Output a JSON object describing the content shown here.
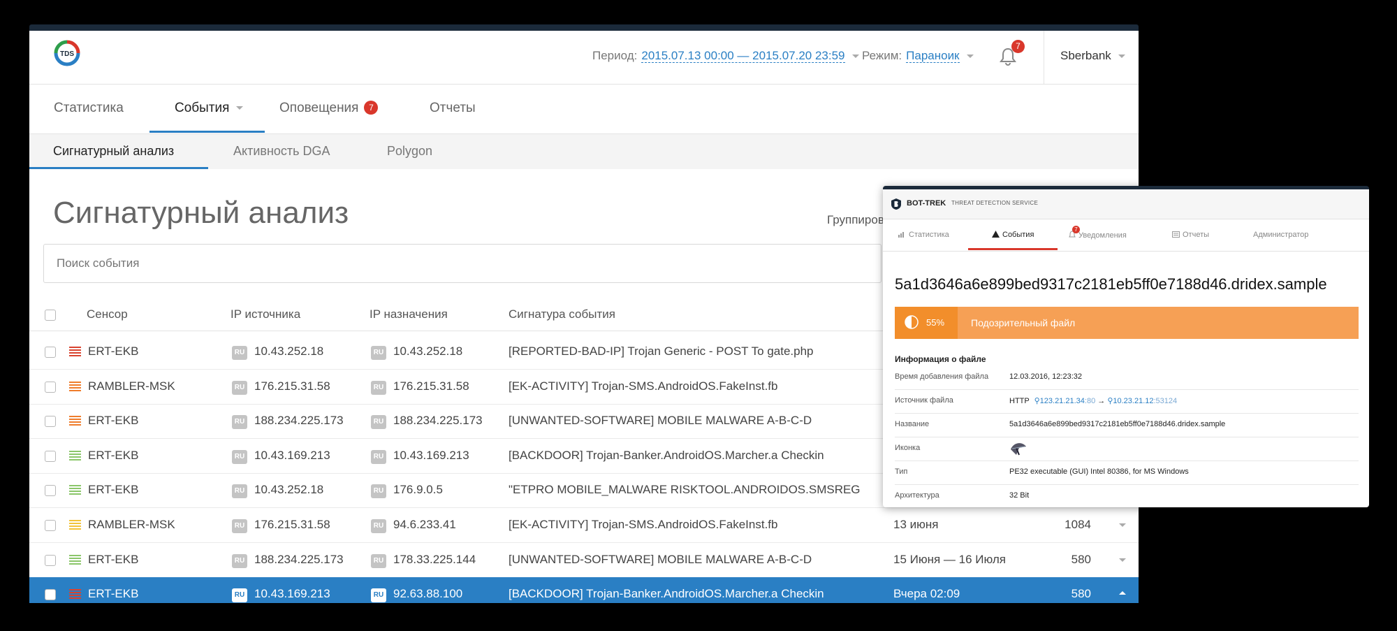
{
  "header": {
    "logo_text": "TDS",
    "period_label": "Период:",
    "period_value": "2015.07.13 00:00 — 2015.07.20 23:59",
    "mode_label": "Режим:",
    "mode_value": "Параноик",
    "notifications_count": "7",
    "user": "Sberbank"
  },
  "nav": {
    "tabs": [
      {
        "label": "Статистика"
      },
      {
        "label": "События"
      },
      {
        "label": "Оповещения",
        "badge": "7"
      },
      {
        "label": "Отчеты"
      }
    ],
    "subtabs": [
      {
        "label": "Сигнатурный анализ"
      },
      {
        "label": "Активность DGA"
      },
      {
        "label": "Polygon"
      }
    ]
  },
  "main": {
    "title": "Сигнатурный анализ",
    "group_label": "Группиров",
    "search_placeholder": "Поиск события"
  },
  "table": {
    "headers": [
      "Сенсор",
      "IP источника",
      "IP назначения",
      "Сигнатура события"
    ],
    "rows": [
      {
        "sensor": "ERT-EKB",
        "severity": "critical",
        "src_cc": "RU",
        "src": "10.43.252.18",
        "dst_cc": "RU",
        "dst": "10.43.252.18",
        "signature": "[REPORTED-BAD-IP] Trojan Generic - POST To gate.php",
        "date": "",
        "count": ""
      },
      {
        "sensor": "RAMBLER-MSK",
        "severity": "high",
        "src_cc": "RU",
        "src": "176.215.31.58",
        "dst_cc": "RU",
        "dst": "176.215.31.58",
        "signature": "[EK-ACTIVITY] Trojan-SMS.AndroidOS.FakeInst.fb",
        "date": "",
        "count": ""
      },
      {
        "sensor": "ERT-EKB",
        "severity": "high",
        "src_cc": "RU",
        "src": "188.234.225.173",
        "dst_cc": "RU",
        "dst": "188.234.225.173",
        "signature": "[UNWANTED-SOFTWARE] MOBILE MALWARE A-B-C-D",
        "date": "",
        "count": ""
      },
      {
        "sensor": "ERT-EKB",
        "severity": "low",
        "src_cc": "RU",
        "src": "10.43.169.213",
        "dst_cc": "RU",
        "dst": "10.43.169.213",
        "signature": "[BACKDOOR] Trojan-Banker.AndroidOS.Marcher.a Checkin",
        "date": "",
        "count": ""
      },
      {
        "sensor": "ERT-EKB",
        "severity": "low",
        "src_cc": "RU",
        "src": "10.43.252.18",
        "dst_cc": "RU",
        "dst": "176.9.0.5",
        "signature": "\"ETPRO MOBILE_MALWARE RISKTOOL.ANDROIDOS.SMSREG",
        "date": "",
        "count": ""
      },
      {
        "sensor": "RAMBLER-MSK",
        "severity": "medium",
        "src_cc": "RU",
        "src": "176.215.31.58",
        "dst_cc": "RU",
        "dst": "94.6.233.41",
        "signature": "[EK-ACTIVITY] Trojan-SMS.AndroidOS.FakeInst.fb",
        "date": "13 июня",
        "count": "1084"
      },
      {
        "sensor": "ERT-EKB",
        "severity": "low",
        "src_cc": "RU",
        "src": "188.234.225.173",
        "dst_cc": "RU",
        "dst": "178.33.225.144",
        "signature": "[UNWANTED-SOFTWARE] MOBILE MALWARE A-B-C-D",
        "date": "15 Июня — 16 Июля",
        "count": "580"
      },
      {
        "sensor": "ERT-EKB",
        "severity": "critical",
        "src_cc": "RU",
        "src": "10.43.169.213",
        "dst_cc": "RU",
        "dst": "92.63.88.100",
        "signature": "[BACKDOOR] Trojan-Banker.AndroidOS.Marcher.a Checkin",
        "date": "Вчера 02:09",
        "count": "580",
        "selected": true
      }
    ]
  },
  "severity_colors": {
    "critical": "#d9432f",
    "high": "#ef7d2c",
    "medium": "#f2c33a",
    "low": "#8bc66a"
  },
  "panel": {
    "brand": "BOT-TREK",
    "brand_sub": "THREAT DETECTION SERVICE",
    "nav": [
      {
        "label": "Статистика"
      },
      {
        "label": "События"
      },
      {
        "label": "Уведомления",
        "badge": "7"
      },
      {
        "label": "Отчеты"
      },
      {
        "label": "Администратор"
      }
    ],
    "file_title": "5a1d3646a6e899bed9317c2181eb5ff0e7188d46.dridex.sample",
    "risk_percent": "55%",
    "risk_label": "Подозрительный файл",
    "info_title": "Информация о файле",
    "info": {
      "added_label": "Время добавления файла",
      "added_value": "12.03.2016, 12:23:32",
      "source_label": "Источник файла",
      "source_proto": "HTTP",
      "source_ip": "123.21.21.34",
      "source_port": ":80",
      "arrow": "→",
      "dest_ip": "10.23.21.12",
      "dest_port": ":53124",
      "name_label": "Название",
      "name_value": "5a1d3646a6e899bed9317c2181eb5ff0e7188d46.dridex.sample",
      "icon_label": "Иконка",
      "type_label": "Тип",
      "type_value": "PE32 executable (GUI) Intel 80386, for MS Windows",
      "arch_label": "Архитектура",
      "arch_value": "32 Bit"
    }
  }
}
